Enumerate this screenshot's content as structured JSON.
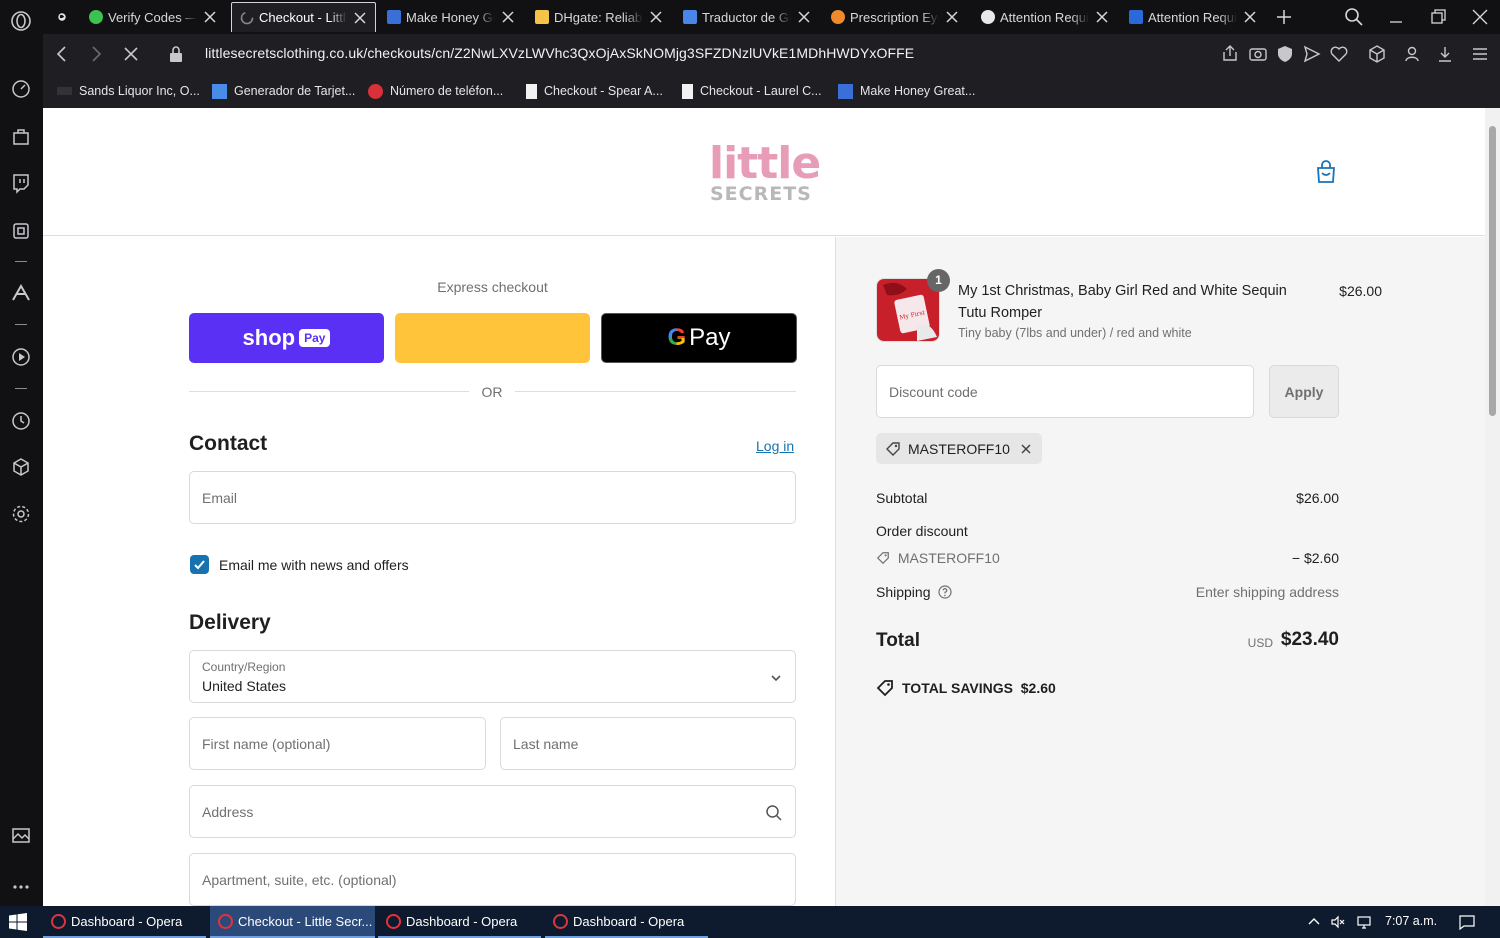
{
  "browser": {
    "tabs": [
      {
        "title": "Verify Codes — S",
        "active": false
      },
      {
        "title": "Checkout - Little",
        "active": true
      },
      {
        "title": "Make Honey Gre",
        "active": false
      },
      {
        "title": "DHgate: Reliable",
        "active": false
      },
      {
        "title": "Traductor de Goo",
        "active": false
      },
      {
        "title": "Prescription Eyeg",
        "active": false
      },
      {
        "title": "Attention Requir",
        "active": false
      },
      {
        "title": "Attention Requir",
        "active": false
      }
    ],
    "url": "littlesecretsclothing.co.uk/checkouts/cn/Z2NwLXVzLWVhc3QxOjAxSkNOMjg3SFZDNzlUVkE1MDhHWDYxOFFE",
    "bookmarks": [
      {
        "label": "Sands Liquor Inc, O..."
      },
      {
        "label": "Generador de Tarjet..."
      },
      {
        "label": "Número de teléfon..."
      },
      {
        "label": "Checkout - Spear A..."
      },
      {
        "label": "Checkout - Laurel C..."
      },
      {
        "label": "Make Honey Great..."
      }
    ]
  },
  "site": {
    "logo_top": "little",
    "logo_bottom": "SECRETS"
  },
  "express": {
    "label": "Express checkout",
    "shop_pay_label": "shop",
    "shop_pay_badge": "Pay",
    "gpay_g": "G",
    "gpay_label": "Pay",
    "or_label": "OR"
  },
  "contact": {
    "title": "Contact",
    "login_label": "Log in",
    "email_placeholder": "Email",
    "newsletter_label": "Email me with news and offers",
    "newsletter_checked": true
  },
  "delivery": {
    "title": "Delivery",
    "country_label": "Country/Region",
    "country_value": "United States",
    "first_name_placeholder": "First name (optional)",
    "last_name_placeholder": "Last name",
    "address_placeholder": "Address",
    "apartment_placeholder": "Apartment, suite, etc. (optional)"
  },
  "order": {
    "item": {
      "quantity": "1",
      "title": "My 1st Christmas, Baby Girl Red and White Sequin Tutu Romper",
      "variant": "Tiny baby (7lbs and under) / red and white",
      "price": "$26.00",
      "thumb_text": "My First Christmas"
    },
    "discount_placeholder": "Discount code",
    "apply_label": "Apply",
    "applied_code": "MASTEROFF10",
    "subtotal_label": "Subtotal",
    "subtotal_value": "$26.00",
    "order_discount_label": "Order discount",
    "discount_code": "MASTEROFF10",
    "discount_value": "− $2.60",
    "shipping_label": "Shipping",
    "shipping_value": "Enter shipping address",
    "total_label": "Total",
    "total_currency": "USD",
    "total_value": "$23.40",
    "savings_label": "TOTAL SAVINGS",
    "savings_value": "$2.60"
  },
  "taskbar": {
    "apps": [
      {
        "label": "Dashboard - Opera",
        "active": false
      },
      {
        "label": "Checkout - Little Secr...",
        "active": true
      },
      {
        "label": "Dashboard - Opera",
        "active": false
      },
      {
        "label": "Dashboard - Opera",
        "active": false
      }
    ],
    "clock": "7:07 a.m."
  },
  "colors": {
    "accent": "#1773b0",
    "shop_pay": "#5a31f4",
    "paypal": "#ffc439",
    "browser_dark": "#1f1f23"
  }
}
